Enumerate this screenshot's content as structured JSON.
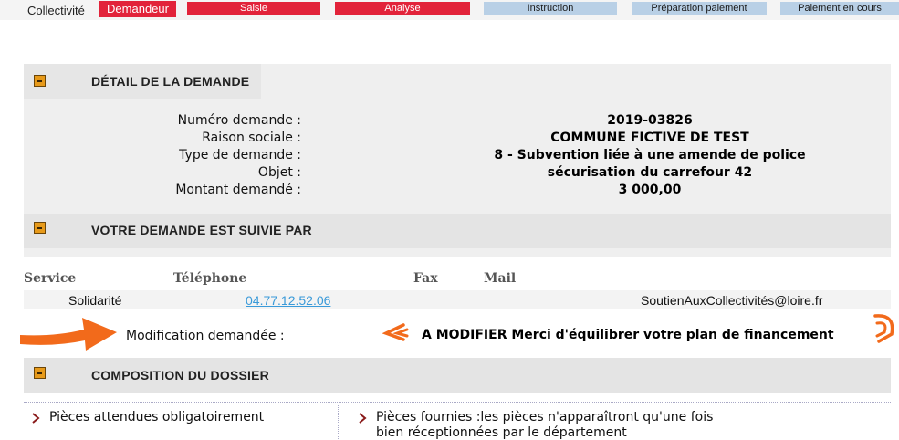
{
  "workflow": {
    "entity_label": "Collectivité",
    "steps": [
      {
        "label": "Demandeur"
      },
      {
        "label": "Saisie"
      },
      {
        "label": "Analyse"
      },
      {
        "label": "Instruction"
      },
      {
        "label": "Préparation paiement"
      },
      {
        "label": "Paiement en cours"
      }
    ]
  },
  "detail": {
    "title": "DÉTAIL DE LA DEMANDE",
    "rows": [
      {
        "label": "Numéro demande :",
        "value": "2019-03826"
      },
      {
        "label": "Raison sociale :",
        "value": "COMMUNE FICTIVE DE TEST"
      },
      {
        "label": "Type de demande :",
        "value": "8 - Subvention liée à une amende de police"
      },
      {
        "label": "Objet :",
        "value": "sécurisation du carrefour 42"
      },
      {
        "label": "Montant demandé :",
        "value": "3 000,00"
      }
    ]
  },
  "suivi": {
    "title": "VOTRE DEMANDE EST SUIVIE PAR",
    "columns": [
      "Service",
      "Téléphone",
      "Fax",
      "Mail"
    ],
    "row": {
      "service": "Solidarité",
      "telephone": "04.77.12.52.06",
      "fax": "",
      "mail": "SoutienAuxCollectivités@loire.fr"
    }
  },
  "modification": {
    "label": "Modification demandée :",
    "value": "A MODIFIER Merci d'équilibrer votre plan de financement"
  },
  "dossier": {
    "title": "COMPOSITION DU DOSSIER",
    "left": "Pièces attendues obligatoirement",
    "right_line1": "Pièces fournies :les pièces n'apparaîtront qu'une fois",
    "right_line2": "bien réceptionnées par le département"
  },
  "colors": {
    "step_active": "#e2233a",
    "step_pending": "#b9d0e6",
    "annotation": "#f26a1b",
    "link": "#3a9ad9",
    "section_icon": "#e79a1a"
  },
  "icons": {
    "section_toggle": "collapse-square-icon",
    "annotation_arrow": "arrow-right-icon",
    "chevron": "chevron-right-icon"
  }
}
